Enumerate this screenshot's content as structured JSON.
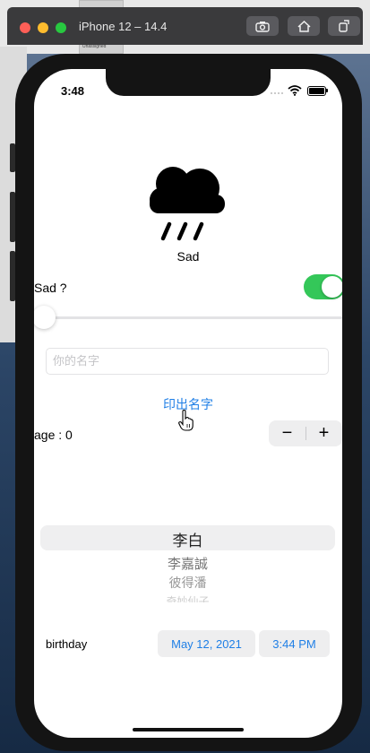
{
  "window": {
    "title": "iPhone 12 – 14.4"
  },
  "desktop": {
    "cell_label": "Unassigned"
  },
  "status_bar": {
    "time": "3:48"
  },
  "weather": {
    "icon": "cloud-rain-icon",
    "mood": "Sad"
  },
  "sad_toggle": {
    "label": "Sad ?",
    "on": true,
    "color": "#34c759"
  },
  "slider": {
    "value": 0
  },
  "name_field": {
    "placeholder": "你的名字",
    "value": ""
  },
  "print_button": {
    "label": "印出名字"
  },
  "age": {
    "label": "age : 0",
    "minus": "−",
    "plus": "+"
  },
  "picker": {
    "options": [
      "李白",
      "李嘉誠",
      "彼得潘",
      "奇妙仙子"
    ],
    "selected": "李白"
  },
  "birthday": {
    "label": "birthday",
    "date": "May 12, 2021",
    "time": "3:44 PM"
  },
  "colors": {
    "accent": "#1f7fe6"
  }
}
